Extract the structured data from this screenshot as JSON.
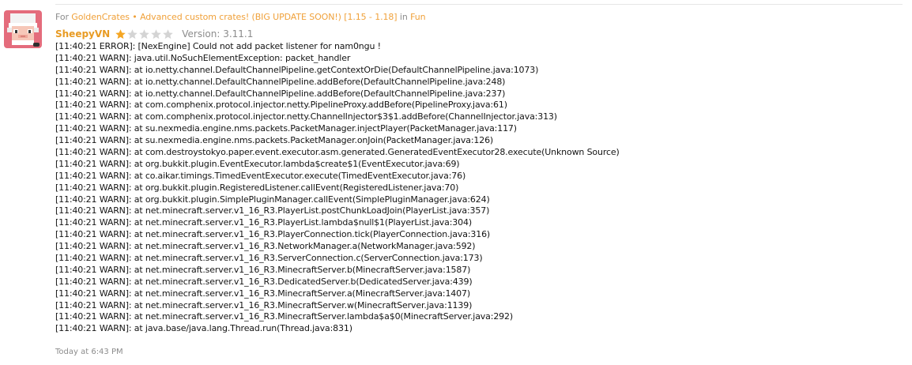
{
  "resource": {
    "for_prefix": "For",
    "resource_name": "GoldenCrates • Advanced custom crates! (BIG UPDATE SOON!) [1.15 - 1.18]",
    "in_prefix": "in",
    "category": "Fun"
  },
  "review": {
    "username": "SheepyVN",
    "rating": 1,
    "rating_max": 5,
    "version": "Version: 3.11.1",
    "timestamp": "Today at 6:43 PM",
    "log_lines": [
      "[11:40:21 ERROR]: [NexEngine] Could not add packet listener for nam0ngu !",
      "[11:40:21 WARN]: java.util.NoSuchElementException: packet_handler",
      "[11:40:21 WARN]: at io.netty.channel.DefaultChannelPipeline.getContextOrDie(DefaultChannelPipeline.java:1073)",
      "[11:40:21 WARN]: at io.netty.channel.DefaultChannelPipeline.addBefore(DefaultChannelPipeline.java:248)",
      "[11:40:21 WARN]: at io.netty.channel.DefaultChannelPipeline.addBefore(DefaultChannelPipeline.java:237)",
      "[11:40:21 WARN]: at com.comphenix.protocol.injector.netty.PipelineProxy.addBefore(PipelineProxy.java:61)",
      "[11:40:21 WARN]: at com.comphenix.protocol.injector.netty.ChannelInjector$3$1.addBefore(ChannelInjector.java:313)",
      "[11:40:21 WARN]: at su.nexmedia.engine.nms.packets.PacketManager.injectPlayer(PacketManager.java:117)",
      "[11:40:21 WARN]: at su.nexmedia.engine.nms.packets.PacketManager.onJoin(PacketManager.java:126)",
      "[11:40:21 WARN]: at com.destroystokyo.paper.event.executor.asm.generated.GeneratedEventExecutor28.execute(Unknown Source)",
      "[11:40:21 WARN]: at org.bukkit.plugin.EventExecutor.lambda$create$1(EventExecutor.java:69)",
      "[11:40:21 WARN]: at co.aikar.timings.TimedEventExecutor.execute(TimedEventExecutor.java:76)",
      "[11:40:21 WARN]: at org.bukkit.plugin.RegisteredListener.callEvent(RegisteredListener.java:70)",
      "[11:40:21 WARN]: at org.bukkit.plugin.SimplePluginManager.callEvent(SimplePluginManager.java:624)",
      "[11:40:21 WARN]: at net.minecraft.server.v1_16_R3.PlayerList.postChunkLoadJoin(PlayerList.java:357)",
      "[11:40:21 WARN]: at net.minecraft.server.v1_16_R3.PlayerList.lambda$null$1(PlayerList.java:304)",
      "[11:40:21 WARN]: at net.minecraft.server.v1_16_R3.PlayerConnection.tick(PlayerConnection.java:316)",
      "[11:40:21 WARN]: at net.minecraft.server.v1_16_R3.NetworkManager.a(NetworkManager.java:592)",
      "[11:40:21 WARN]: at net.minecraft.server.v1_16_R3.ServerConnection.c(ServerConnection.java:173)",
      "[11:40:21 WARN]: at net.minecraft.server.v1_16_R3.MinecraftServer.b(MinecraftServer.java:1587)",
      "[11:40:21 WARN]: at net.minecraft.server.v1_16_R3.DedicatedServer.b(DedicatedServer.java:439)",
      "[11:40:21 WARN]: at net.minecraft.server.v1_16_R3.MinecraftServer.a(MinecraftServer.java:1407)",
      "[11:40:21 WARN]: at net.minecraft.server.v1_16_R3.MinecraftServer.w(MinecraftServer.java:1139)",
      "[11:40:21 WARN]: at net.minecraft.server.v1_16_R3.MinecraftServer.lambda$a$0(MinecraftServer.java:292)",
      "[11:40:21 WARN]: at java.base/java.lang.Thread.run(Thread.java:831)"
    ]
  },
  "colors": {
    "link": "#f0a13a",
    "username": "#e89b23",
    "star_filled": "#f5a623",
    "star_empty": "#d4d4d4",
    "muted_text": "#8c8c8c",
    "log_text": "#141414"
  },
  "icons": {
    "avatar": "pixel-sheep-avatar",
    "rating_star": "star-icon"
  }
}
